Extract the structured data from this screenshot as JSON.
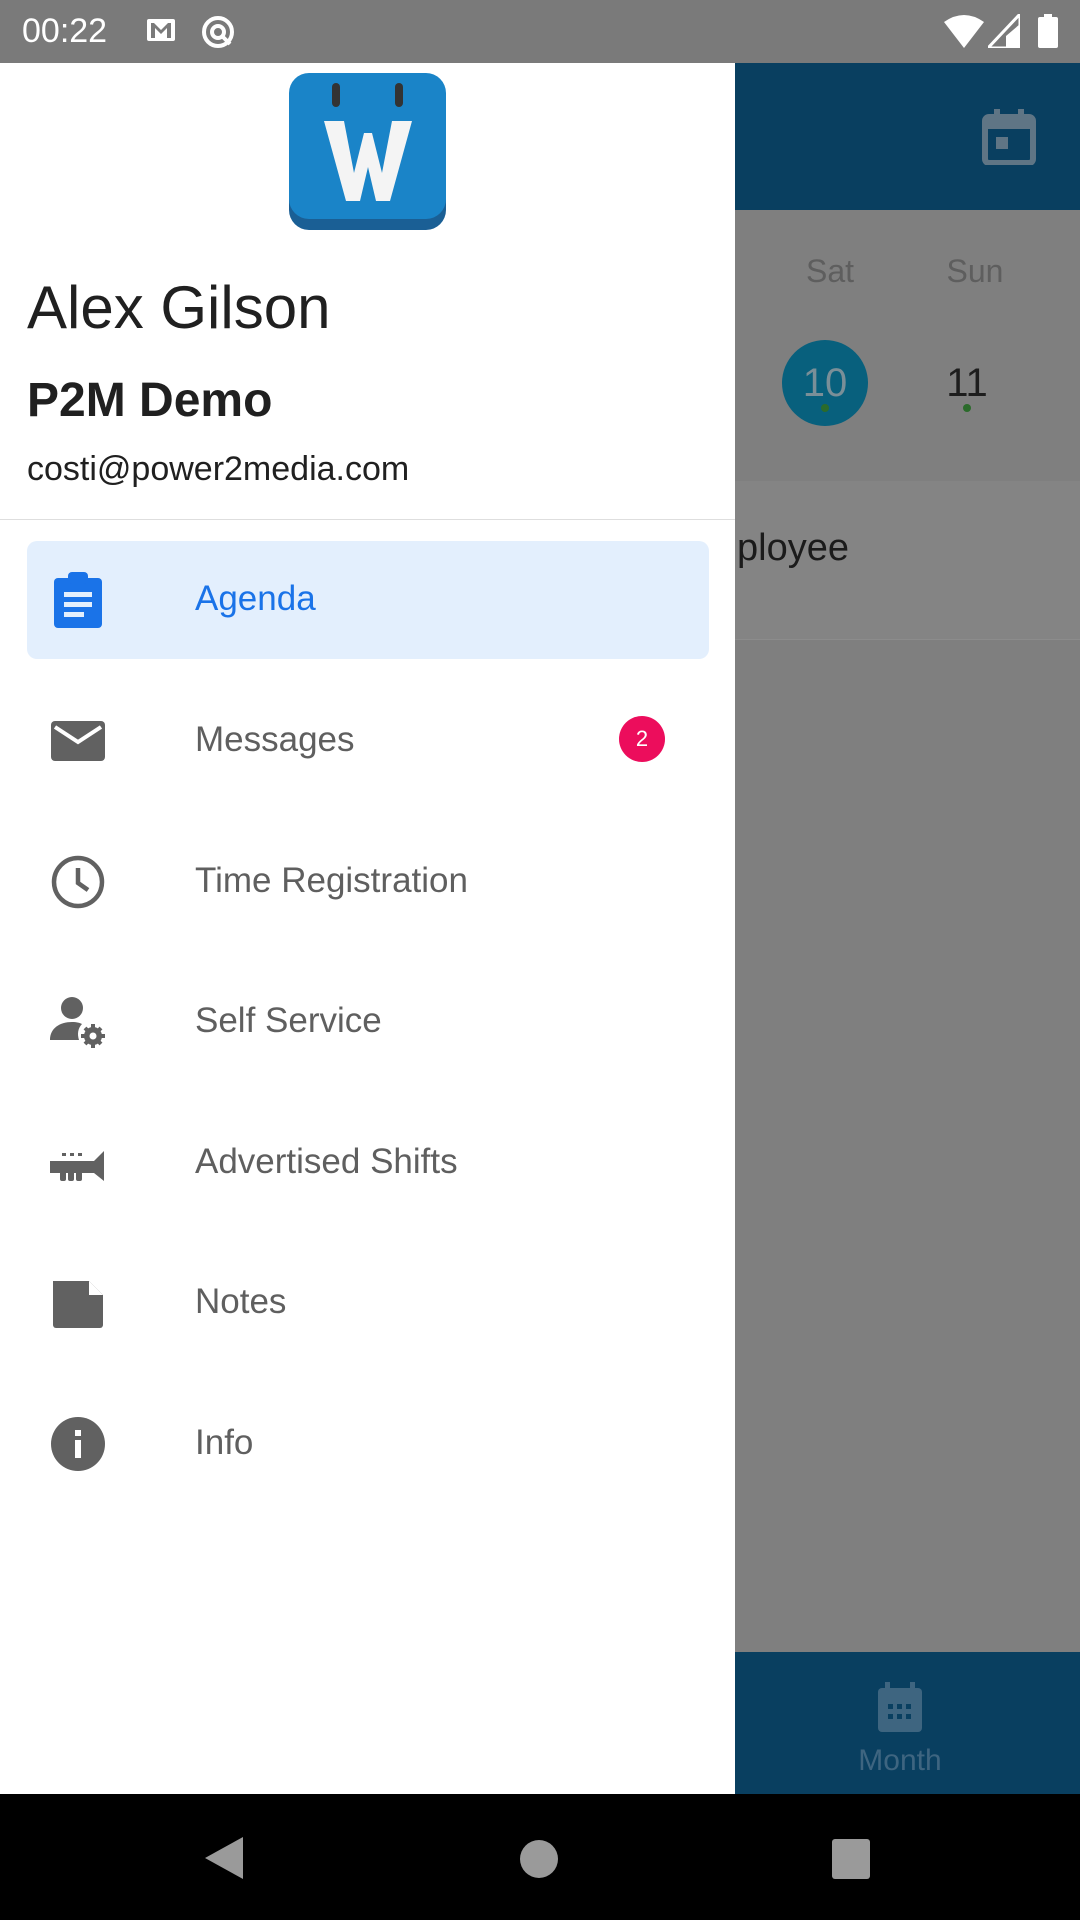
{
  "status_bar": {
    "time": "00:22",
    "icons": [
      "gmail-icon",
      "at-sign-icon",
      "wifi-icon",
      "signal-icon",
      "battery-icon"
    ]
  },
  "background": {
    "days": [
      {
        "name": "Sat",
        "number": "10",
        "selected": true
      },
      {
        "name": "Sun",
        "number": "11",
        "selected": false
      }
    ],
    "partial_text": "ployee",
    "bottom_tab": {
      "label": "Month",
      "icon": "calendar-month-icon"
    },
    "colors": {
      "appbar": "#093f60",
      "selected_day": "#08607d"
    }
  },
  "drawer": {
    "user_name": "Alex Gilson",
    "organization": "P2M Demo",
    "email": "costi@power2media.com",
    "items": [
      {
        "label": "Agenda",
        "icon": "clipboard-icon",
        "active": true
      },
      {
        "label": "Messages",
        "icon": "mail-icon",
        "badge": "2"
      },
      {
        "label": "Time Registration",
        "icon": "clock-icon"
      },
      {
        "label": "Self Service",
        "icon": "user-settings-icon"
      },
      {
        "label": "Advertised Shifts",
        "icon": "trumpet-icon"
      },
      {
        "label": "Notes",
        "icon": "note-icon"
      },
      {
        "label": "Info",
        "icon": "info-icon"
      }
    ],
    "colors": {
      "accent": "#1a73e8",
      "active_bg": "#e3effd",
      "badge": "#ec0d5c"
    }
  }
}
